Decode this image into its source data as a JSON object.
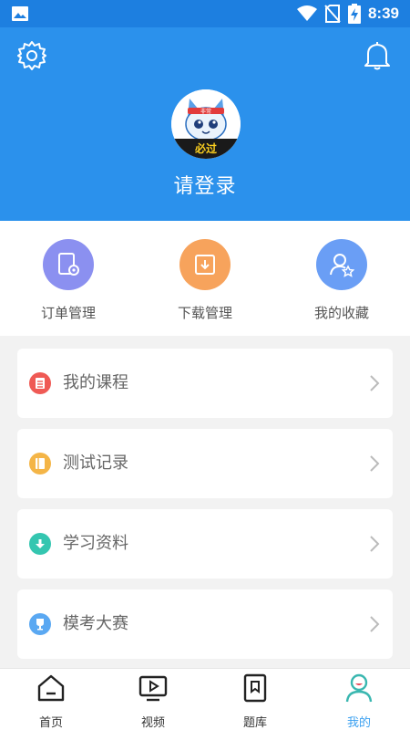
{
  "status_bar": {
    "time": "8:39",
    "icons": [
      "image-icon",
      "wifi-icon",
      "no-sim-icon",
      "battery-charging-icon"
    ]
  },
  "header": {
    "login_text": "请登录",
    "avatar_badge": "必过",
    "avatar_hat": "非常"
  },
  "quick_actions": [
    {
      "label": "订单管理",
      "icon": "order-settings-icon",
      "color": "#7f8cf2"
    },
    {
      "label": "下载管理",
      "icon": "download-icon",
      "color": "#f7a35c"
    },
    {
      "label": "我的收藏",
      "icon": "favorite-user-icon",
      "color": "#6a9ef5"
    }
  ],
  "menu": [
    {
      "label": "我的课程",
      "icon": "list-icon",
      "color": "#ef5a55"
    },
    {
      "label": "测试记录",
      "icon": "book-icon",
      "color": "#f4b547"
    },
    {
      "label": "学习资料",
      "icon": "download-arrow-icon",
      "color": "#34c6b0"
    },
    {
      "label": "模考大赛",
      "icon": "trophy-icon",
      "color": "#5aa8f2"
    }
  ],
  "tabbar": [
    {
      "label": "首页",
      "icon": "home-icon",
      "active": false
    },
    {
      "label": "视频",
      "icon": "video-icon",
      "active": false
    },
    {
      "label": "题库",
      "icon": "question-bank-icon",
      "active": false
    },
    {
      "label": "我的",
      "icon": "profile-icon",
      "active": true
    }
  ],
  "colors": {
    "primary": "#2b91ec",
    "status_bar": "#1d7fe0",
    "active_tab": "#3aa0f0"
  }
}
